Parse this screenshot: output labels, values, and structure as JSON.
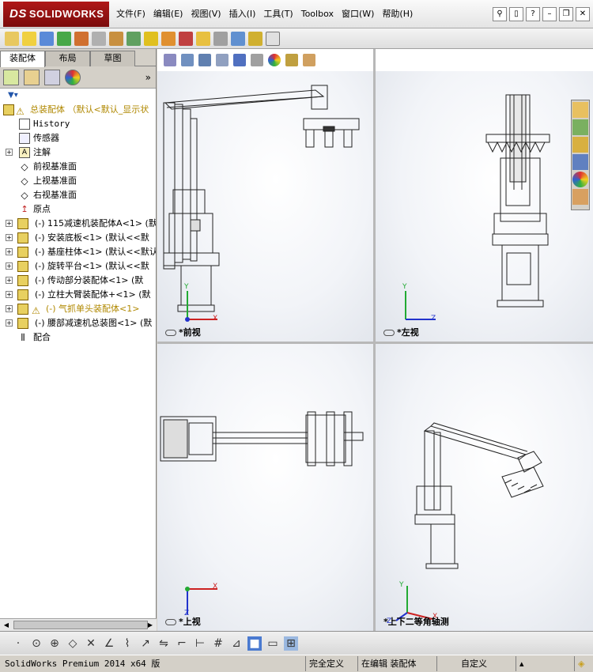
{
  "app": {
    "brand": "SOLIDWORKS",
    "brand_prefix": "DS"
  },
  "menu": [
    "文件(F)",
    "编辑(E)",
    "视图(V)",
    "插入(I)",
    "工具(T)",
    "Toolbox",
    "窗口(W)",
    "帮助(H)"
  ],
  "left_tabs": [
    "装配体",
    "布局",
    "草图"
  ],
  "tree": {
    "root": "总装配体 （默认<默认_显示状",
    "items": [
      {
        "label": "History"
      },
      {
        "label": "传感器"
      },
      {
        "label": "注解"
      },
      {
        "label": "前视基准面"
      },
      {
        "label": "上视基准面"
      },
      {
        "label": "右视基准面"
      },
      {
        "label": "原点"
      },
      {
        "label": "(-) 115减速机装配体A<1> (默"
      },
      {
        "label": "(-) 安装底板<1> (默认<<默"
      },
      {
        "label": "(-) 基座柱体<1> (默认<<默认"
      },
      {
        "label": "(-) 旋转平台<1> (默认<<默"
      },
      {
        "label": "(-) 传动部分装配体<1> (默"
      },
      {
        "label": "(-) 立柱大臂装配体+<1> (默"
      },
      {
        "label": "(-) 气抓单头装配体<1>"
      },
      {
        "label": "(-) 腰部减速机总装图<1> (默"
      },
      {
        "label": "配合"
      }
    ]
  },
  "views": {
    "front": "*前视",
    "left": "*左视",
    "top": "*上视",
    "iso": "*上下二等角轴测"
  },
  "axes": {
    "x": "X",
    "y": "Y",
    "z": "Z"
  },
  "status": {
    "version": "SolidWorks Premium 2014 x64 版",
    "defined": "完全定义",
    "editing": "在编辑 装配体",
    "custom": "自定义"
  },
  "colors": {
    "brand_red": "#9c1414",
    "axis_x": "#cc2222",
    "axis_y": "#22aa33",
    "axis_z": "#2233cc"
  }
}
